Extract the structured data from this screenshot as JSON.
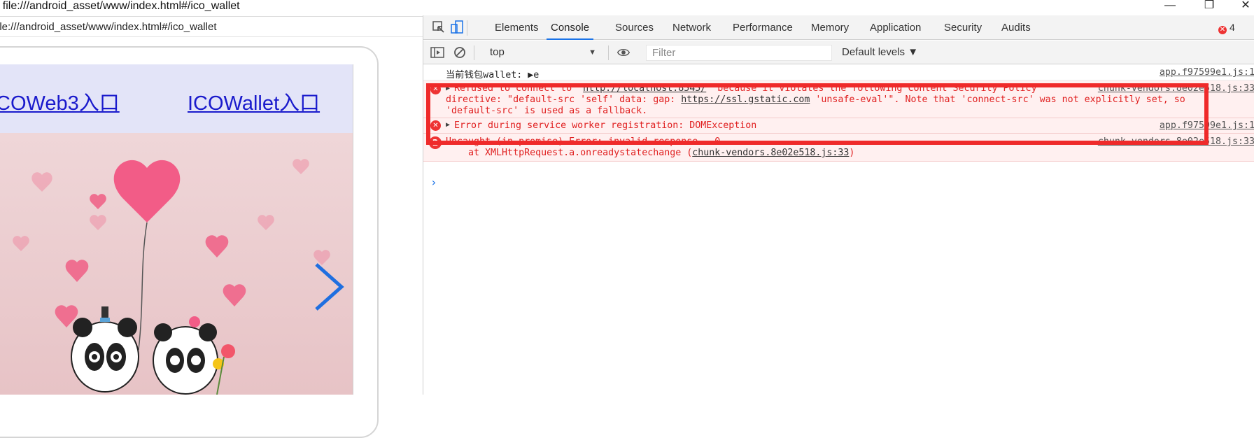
{
  "window": {
    "title": "- file:///android_asset/www/index.html#/ico_wallet",
    "minimize_glyph": "—",
    "restore_glyph": "❐",
    "close_glyph": "✕"
  },
  "address": {
    "url": "ile:///android_asset/www/index.html#/ico_wallet"
  },
  "page": {
    "nav_links": [
      "COWeb3入口",
      "ICOWallet入口"
    ],
    "next_arrow": "next-slide"
  },
  "devtools": {
    "tabs": [
      "Elements",
      "Console",
      "Sources",
      "Network",
      "Performance",
      "Memory",
      "Application",
      "Security",
      "Audits"
    ],
    "active_tab": "Console",
    "error_count": "4",
    "context": "top",
    "filter_placeholder": "Filter",
    "levels": "Default levels ▼"
  },
  "console": {
    "messages": [
      {
        "text": "当前钱包wallet: ▶e",
        "source": "app.f97599e1.js:1",
        "level": "info"
      },
      {
        "prefix": "Refused to connect to '",
        "link1": "http://localhost:8545/",
        "mid": "' because it violates the following Content Security Policy",
        "line2a": "directive: \"default-src 'self' data: gap: ",
        "link2": "https://ssl.gstatic.com",
        "line2b": " 'unsafe-eval'\". Note that 'connect-src' was not explicitly set, so",
        "line3": "'default-src' is used as a fallback.",
        "source": "chunk-vendors.8e02e518.js:33",
        "level": "error"
      },
      {
        "text": "Error during service worker registration: DOMException",
        "source": "app.f97599e1.js:1",
        "level": "error"
      },
      {
        "text": "Uncaught (in promise) Error: invalid response - 0",
        "line2a": "    at XMLHttpRequest.a.onreadystatechange (",
        "link": "chunk-vendors.8e02e518.js:33",
        "line2b": ")",
        "source": "chunk-vendors.8e02e518.js:33",
        "repeat": "2",
        "level": "error"
      }
    ],
    "prompt": "›"
  },
  "colors": {
    "error": "#e02020",
    "accent": "#1a73e8",
    "highlight": "#ef2a2a"
  }
}
